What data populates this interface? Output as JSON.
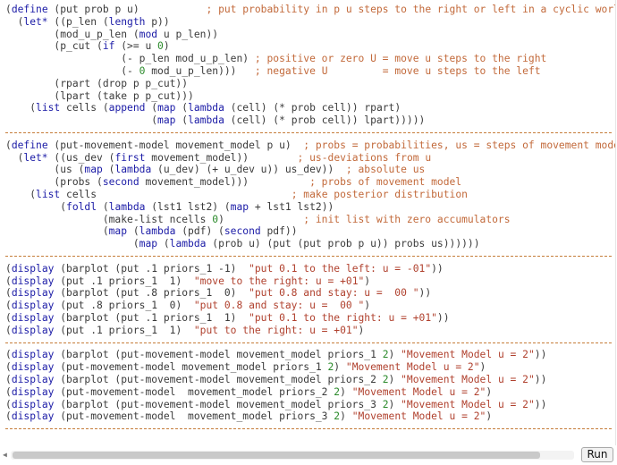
{
  "editor": {
    "lines": [
      {
        "sep": false,
        "tokens": [
          [
            "(",
            ""
          ],
          [
            "define",
            "kw"
          ],
          [
            " (put prob p u)           ",
            ""
          ],
          [
            "; put probability in p u steps to the right or left in a cyclic world",
            "com"
          ]
        ]
      },
      {
        "sep": false,
        "tokens": [
          [
            "  (",
            ""
          ],
          [
            "let*",
            "kw"
          ],
          [
            " ((p_len (",
            ""
          ],
          [
            "length",
            "kw"
          ],
          [
            " p))",
            ""
          ]
        ]
      },
      {
        "sep": false,
        "tokens": [
          [
            "        (mod_u_p_len (",
            ""
          ],
          [
            "mod",
            "kw"
          ],
          [
            " u p_len))",
            ""
          ]
        ]
      },
      {
        "sep": false,
        "tokens": [
          [
            "        (p_cut (",
            ""
          ],
          [
            "if",
            "kw"
          ],
          [
            " (>= u ",
            ""
          ],
          [
            "0",
            "num"
          ],
          [
            ")",
            ""
          ]
        ]
      },
      {
        "sep": false,
        "tokens": [
          [
            "                   (- p_len mod_u_p_len) ",
            ""
          ],
          [
            "; positive or zero U = move u steps to the right",
            "com"
          ]
        ]
      },
      {
        "sep": false,
        "tokens": [
          [
            "                   (- ",
            ""
          ],
          [
            "0",
            "num"
          ],
          [
            " mod_u_p_len)))   ",
            ""
          ],
          [
            "; negative U         = move u steps to the left",
            "com"
          ]
        ]
      },
      {
        "sep": false,
        "tokens": [
          [
            "        (rpart (drop p p_cut))",
            ""
          ]
        ]
      },
      {
        "sep": false,
        "tokens": [
          [
            "        (lpart (take p p_cut)))",
            ""
          ]
        ]
      },
      {
        "sep": false,
        "tokens": [
          [
            "    (",
            ""
          ],
          [
            "list",
            "kw"
          ],
          [
            " cells (",
            ""
          ],
          [
            "append",
            "kw"
          ],
          [
            " (",
            ""
          ],
          [
            "map",
            "kw"
          ],
          [
            " (",
            ""
          ],
          [
            "lambda",
            "kw"
          ],
          [
            " (cell) (* prob cell)) rpart)",
            ""
          ]
        ]
      },
      {
        "sep": false,
        "tokens": [
          [
            "                        (",
            ""
          ],
          [
            "map",
            "kw"
          ],
          [
            " (",
            ""
          ],
          [
            "lambda",
            "kw"
          ],
          [
            " (cell) (* prob cell)) lpart)))))",
            ""
          ]
        ]
      },
      {
        "sep": true,
        "tokens": []
      },
      {
        "sep": false,
        "tokens": [
          [
            "(",
            ""
          ],
          [
            "define",
            "kw"
          ],
          [
            " (put-movement-model movement_model p u)  ",
            ""
          ],
          [
            "; probs = probabilities, us = steps of movement model",
            "com"
          ]
        ]
      },
      {
        "sep": false,
        "tokens": [
          [
            "  (",
            ""
          ],
          [
            "let*",
            "kw"
          ],
          [
            " ((us_dev (",
            ""
          ],
          [
            "first",
            "kw"
          ],
          [
            " movement_model))        ",
            ""
          ],
          [
            "; us-deviations from u",
            "com"
          ]
        ]
      },
      {
        "sep": false,
        "tokens": [
          [
            "        (us (",
            ""
          ],
          [
            "map",
            "kw"
          ],
          [
            " (",
            ""
          ],
          [
            "lambda",
            "kw"
          ],
          [
            " (u_dev) (+ u_dev u)) us_dev))  ",
            ""
          ],
          [
            "; absolute us",
            "com"
          ]
        ]
      },
      {
        "sep": false,
        "tokens": [
          [
            "        (probs (",
            ""
          ],
          [
            "second",
            "kw"
          ],
          [
            " movement_model)))          ",
            ""
          ],
          [
            "; probs of movement model",
            "com"
          ]
        ]
      },
      {
        "sep": false,
        "tokens": [
          [
            "    (",
            ""
          ],
          [
            "list",
            "kw"
          ],
          [
            " cells                                ",
            ""
          ],
          [
            "; make posterior distribution",
            "com"
          ]
        ]
      },
      {
        "sep": false,
        "tokens": [
          [
            "         (",
            ""
          ],
          [
            "foldl",
            "kw"
          ],
          [
            " (",
            ""
          ],
          [
            "lambda",
            "kw"
          ],
          [
            " (lst1 lst2) (",
            ""
          ],
          [
            "map",
            "kw"
          ],
          [
            " + lst1 lst2))",
            ""
          ]
        ]
      },
      {
        "sep": false,
        "tokens": [
          [
            "                (make-list ncells ",
            ""
          ],
          [
            "0",
            "num"
          ],
          [
            ")             ",
            ""
          ],
          [
            "; init list with zero accumulators",
            "com"
          ]
        ]
      },
      {
        "sep": false,
        "tokens": [
          [
            "                (",
            ""
          ],
          [
            "map",
            "kw"
          ],
          [
            " (",
            ""
          ],
          [
            "lambda",
            "kw"
          ],
          [
            " (pdf) (",
            ""
          ],
          [
            "second",
            "kw"
          ],
          [
            " pdf))",
            ""
          ]
        ]
      },
      {
        "sep": false,
        "tokens": [
          [
            "                     (",
            ""
          ],
          [
            "map",
            "kw"
          ],
          [
            " (",
            ""
          ],
          [
            "lambda",
            "kw"
          ],
          [
            " (prob u) (put (put prob p u)) probs us))))))",
            ""
          ]
        ]
      },
      {
        "sep": true,
        "tokens": []
      },
      {
        "sep": false,
        "tokens": [
          [
            "(",
            ""
          ],
          [
            "display",
            "kw"
          ],
          [
            " (barplot (put .1 priors_1 -1)  ",
            ""
          ],
          [
            "\"put 0.1 to the left: u = -01\"",
            "str"
          ],
          [
            "))",
            ""
          ]
        ]
      },
      {
        "sep": false,
        "tokens": [
          [
            "(",
            ""
          ],
          [
            "display",
            "kw"
          ],
          [
            " (put .1 priors_1  1)  ",
            ""
          ],
          [
            "\"move to the right: u = +01\"",
            "str"
          ],
          [
            ")",
            ""
          ]
        ]
      },
      {
        "sep": false,
        "tokens": [
          [
            "(",
            ""
          ],
          [
            "display",
            "kw"
          ],
          [
            " (barplot (put .8 priors_1  0)  ",
            ""
          ],
          [
            "\"put 0.8 and stay: u =  00 \"",
            "str"
          ],
          [
            "))",
            ""
          ]
        ]
      },
      {
        "sep": false,
        "tokens": [
          [
            "(",
            ""
          ],
          [
            "display",
            "kw"
          ],
          [
            " (put .8 priors_1  0)  ",
            ""
          ],
          [
            "\"put 0.8 and stay: u =  00 \"",
            "str"
          ],
          [
            ")",
            ""
          ]
        ]
      },
      {
        "sep": false,
        "tokens": [
          [
            "(",
            ""
          ],
          [
            "display",
            "kw"
          ],
          [
            " (barplot (put .1 priors_1  1)  ",
            ""
          ],
          [
            "\"put 0.1 to the right: u = +01\"",
            "str"
          ],
          [
            "))",
            ""
          ]
        ]
      },
      {
        "sep": false,
        "tokens": [
          [
            "(",
            ""
          ],
          [
            "display",
            "kw"
          ],
          [
            " (put .1 priors_1  1)  ",
            ""
          ],
          [
            "\"put to the right: u = +01\"",
            "str"
          ],
          [
            ")",
            ""
          ]
        ]
      },
      {
        "sep": true,
        "tokens": []
      },
      {
        "sep": false,
        "tokens": [
          [
            "(",
            ""
          ],
          [
            "display",
            "kw"
          ],
          [
            " (barplot (put-movement-model movement_model priors_1 ",
            ""
          ],
          [
            "2",
            "num"
          ],
          [
            ") ",
            ""
          ],
          [
            "\"Movement Model u = 2\"",
            "str"
          ],
          [
            "))",
            ""
          ]
        ]
      },
      {
        "sep": false,
        "tokens": [
          [
            "(",
            ""
          ],
          [
            "display",
            "kw"
          ],
          [
            " (put-movement-model movement_model priors_1 ",
            ""
          ],
          [
            "2",
            "num"
          ],
          [
            ") ",
            ""
          ],
          [
            "\"Movement Model u = 2\"",
            "str"
          ],
          [
            ")",
            ""
          ]
        ]
      },
      {
        "sep": false,
        "tokens": [
          [
            "(",
            ""
          ],
          [
            "display",
            "kw"
          ],
          [
            " (barplot (put-movement-model movement_model priors_2 ",
            ""
          ],
          [
            "2",
            "num"
          ],
          [
            ") ",
            ""
          ],
          [
            "\"Movement Model u = 2\"",
            "str"
          ],
          [
            "))",
            ""
          ]
        ]
      },
      {
        "sep": false,
        "tokens": [
          [
            "(",
            ""
          ],
          [
            "display",
            "kw"
          ],
          [
            " (put-movement-model  movement_model priors_2 ",
            ""
          ],
          [
            "2",
            "num"
          ],
          [
            ") ",
            ""
          ],
          [
            "\"Movement Model u = 2\"",
            "str"
          ],
          [
            ")",
            ""
          ]
        ]
      },
      {
        "sep": false,
        "tokens": [
          [
            "(",
            ""
          ],
          [
            "display",
            "kw"
          ],
          [
            " (barplot (put-movement-model movement_model priors_3 ",
            ""
          ],
          [
            "2",
            "num"
          ],
          [
            ") ",
            ""
          ],
          [
            "\"Movement Model u = 2\"",
            "str"
          ],
          [
            "))",
            ""
          ]
        ]
      },
      {
        "sep": false,
        "tokens": [
          [
            "(",
            ""
          ],
          [
            "display",
            "kw"
          ],
          [
            " (put-movement-model  movement_model priors_3 ",
            ""
          ],
          [
            "2",
            "num"
          ],
          [
            ") ",
            ""
          ],
          [
            "\"Movement Model u = 2\"",
            "str"
          ],
          [
            ")",
            ""
          ]
        ]
      },
      {
        "sep": true,
        "tokens": []
      }
    ]
  },
  "toolbar": {
    "run_label": "Run",
    "scroll_left_icon": "triangle-left-icon"
  },
  "colors": {
    "keyword": "#1a1aa6",
    "string": "#b0412e",
    "comment": "#c2693a",
    "number": "#2a8a2a",
    "text": "#3a3a3a",
    "separator": "#c57d3a"
  }
}
